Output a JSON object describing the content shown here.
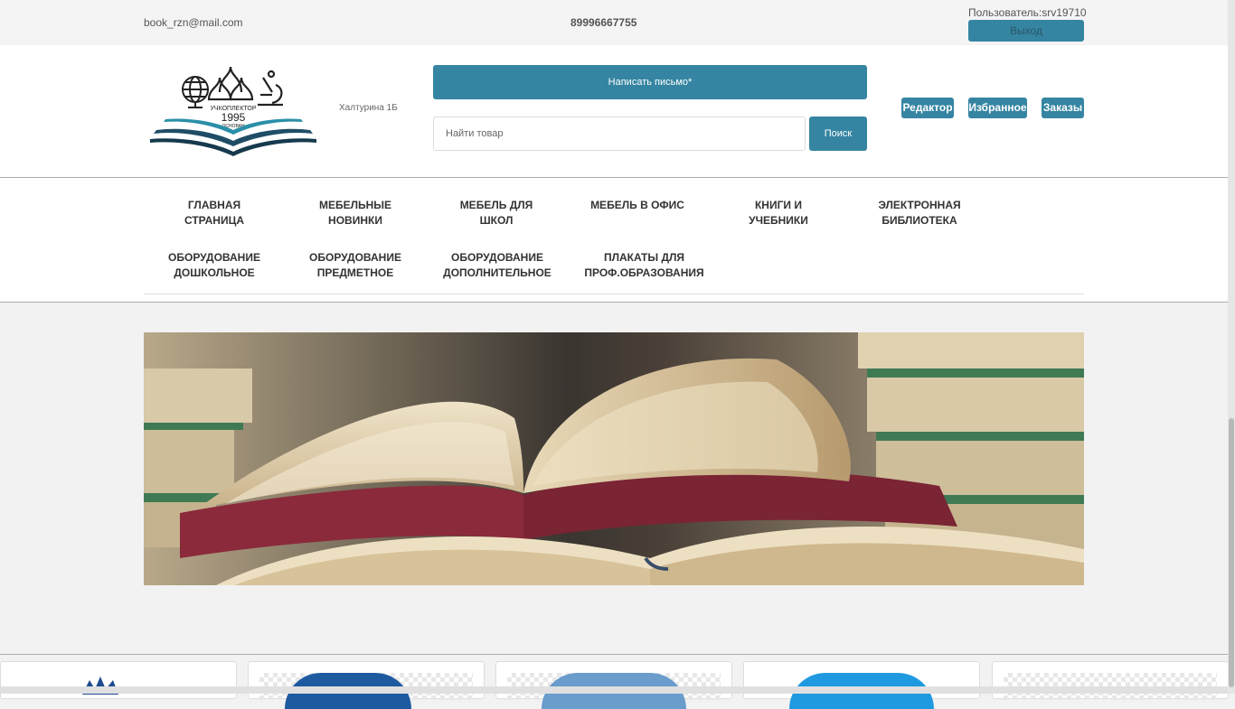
{
  "topbar": {
    "email": "book_rzn@mail.com",
    "phone": "89996667755",
    "user": "Пользователь:srv19710",
    "logout_label": "Выход"
  },
  "header": {
    "logo": {
      "text_top": "УЧКОПЛЕКТОР",
      "year": "1995",
      "text_bottom": "ОСНОВАН"
    },
    "address": "Халтурина 1Б",
    "write_label": "Написать письмо*",
    "search_placeholder": "Найти товар",
    "search_label": "Поиск",
    "buttons": {
      "editor": "Редактор",
      "favorites": "Избранное",
      "orders": "Заказы"
    },
    "accent_color": "#3585a2"
  },
  "nav": {
    "items": [
      {
        "line1": "ГЛАВНАЯ",
        "line2": "СТРАНИЦА"
      },
      {
        "line1": "МЕБЕЛЬНЫЕ",
        "line2": "НОВИНКИ"
      },
      {
        "line1": "МЕБЕЛЬ ДЛЯ",
        "line2": "ШКОЛ"
      },
      {
        "line1": "МЕБЕЛЬ В ОФИС",
        "line2": ""
      },
      {
        "line1": "КНИГИ И",
        "line2": "УЧЕБНИКИ"
      },
      {
        "line1": "ЭЛЕКТРОННАЯ",
        "line2": "БИБЛИОТЕКА"
      },
      {
        "line1": "ОБОРУДОВАНИЕ",
        "line2": "ДОШКОЛЬНОЕ"
      },
      {
        "line1": "ОБОРУДОВАНИЕ",
        "line2": "ПРЕДМЕТНОЕ"
      },
      {
        "line1": "ОБОРУДОВАНИЕ",
        "line2": "ДОПОЛНИТЕЛЬНОЕ"
      },
      {
        "line1": "ПЛАКАТЫ ДЛЯ",
        "line2": "ПРОФ.ОБРАЗОВАНИЯ"
      }
    ]
  }
}
